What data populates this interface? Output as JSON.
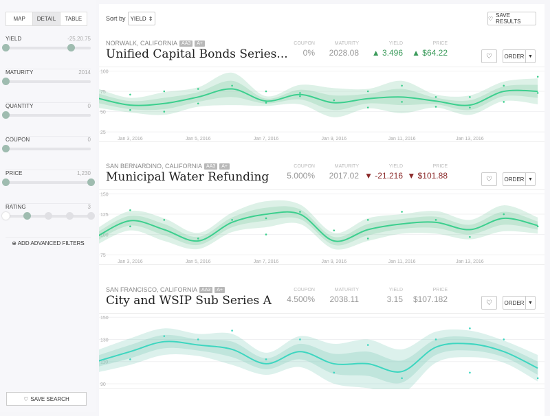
{
  "sidebar": {
    "tabs": [
      {
        "label": "MAP"
      },
      {
        "label": "DETAIL",
        "active": true
      },
      {
        "label": "TABLE"
      }
    ],
    "filters": [
      {
        "label": "YIELD",
        "value": "-25,20.75",
        "thumbs": [
          0,
          0.77
        ]
      },
      {
        "label": "MATURITY",
        "value": "2014",
        "thumbs": [
          0
        ]
      },
      {
        "label": "QUANTITY",
        "value": "0",
        "thumbs": [
          0
        ]
      },
      {
        "label": "COUPON",
        "value": "0",
        "thumbs": [
          0
        ]
      },
      {
        "label": "PRICE",
        "value": "1,230",
        "thumbs": [
          0,
          1
        ]
      },
      {
        "label": "RATING",
        "value": "3",
        "steps": 5,
        "selected_step": 1
      }
    ],
    "add_filters": "ADD ADVANCED FILTERS",
    "save_search": "SAVE SEARCH"
  },
  "toolbar": {
    "sort_label": "Sort by",
    "sort_value": "YIELD",
    "save_results": "SAVE RESULTS"
  },
  "colors": {
    "up": "#3a9a5a",
    "down": "#8b2a2a",
    "line_green": "#3ccf8e",
    "line_teal": "#3dd6c0"
  },
  "bonds": [
    {
      "location": "NORWALK, CALIFORNIA",
      "badges": [
        "AA3",
        "A+"
      ],
      "title": "Unified Capital Bonds Series...",
      "coupon_label": "COUPON",
      "coupon": "0%",
      "maturity_label": "MATURITY",
      "maturity": "2028.08",
      "yield_label": "YIELD",
      "yield": "3.496",
      "yield_dir": "up",
      "price_label": "PRICE",
      "price": "$64.22",
      "price_dir": "up",
      "order": "ORDER"
    },
    {
      "location": "SAN BERNARDINO, CALIFORNIA",
      "badges": [
        "AA3",
        "A+"
      ],
      "title": "Municipal Water Refunding",
      "coupon_label": "COUPON",
      "coupon": "5.000%",
      "maturity_label": "MATURITY",
      "maturity": "2017.02",
      "yield_label": "YIELD",
      "yield": "-21.216",
      "yield_dir": "down",
      "price_label": "PRICE",
      "price": "$101.88",
      "price_dir": "down",
      "order": "ORDER"
    },
    {
      "location": "SAN FRANCISCO, CALIFORNIA",
      "badges": [
        "AA3",
        "A+"
      ],
      "title": "City and WSIP Sub Series A",
      "coupon_label": "COUPON",
      "coupon": "4.500%",
      "maturity_label": "MATURITY",
      "maturity": "2038.11",
      "yield_label": "YIELD",
      "yield": "3.15",
      "yield_dir": "none",
      "price_label": "PRICE",
      "price": "$107.182",
      "price_dir": "none",
      "order": "ORDER"
    }
  ],
  "chart_data": [
    {
      "type": "line",
      "color": "#3ccf8e",
      "yticks": [
        100,
        75,
        50,
        25
      ],
      "ylim": [
        20,
        103
      ],
      "xticks": [
        "Jan 3, 2016",
        "Jan 5, 2016",
        "Jan 7, 2016",
        "Jan 9, 2016",
        "Jan 11, 2016",
        "Jan 13, 2016"
      ],
      "x": [
        "2016-01-02",
        "2016-01-03",
        "2016-01-04",
        "2016-01-05",
        "2016-01-06",
        "2016-01-07",
        "2016-01-08",
        "2016-01-09",
        "2016-01-10",
        "2016-01-11",
        "2016-01-12",
        "2016-01-13",
        "2016-01-14",
        "2016-01-15"
      ],
      "values": [
        67,
        58,
        60,
        68,
        78,
        63,
        71,
        61,
        66,
        68,
        63,
        58,
        75,
        75
      ],
      "outer_spread": [
        12,
        9,
        14,
        12,
        20,
        6,
        12,
        18,
        12,
        20,
        8,
        12,
        12,
        16
      ],
      "inner_spread": [
        6,
        5,
        7,
        6,
        10,
        3,
        6,
        9,
        6,
        10,
        4,
        6,
        6,
        8
      ],
      "points": [
        [
          2,
          80
        ],
        [
          2,
          68
        ],
        [
          3,
          71
        ],
        [
          3,
          52
        ],
        [
          4,
          75
        ],
        [
          4,
          50
        ],
        [
          5,
          78
        ],
        [
          5,
          60
        ],
        [
          6,
          82
        ],
        [
          7,
          75
        ],
        [
          7,
          61
        ],
        [
          8,
          73
        ],
        [
          8,
          69
        ],
        [
          9,
          64
        ],
        [
          10,
          75
        ],
        [
          10,
          55
        ],
        [
          11,
          82
        ],
        [
          11,
          62
        ],
        [
          12,
          68
        ],
        [
          12,
          56
        ],
        [
          13,
          68
        ],
        [
          13,
          55
        ],
        [
          14,
          82
        ],
        [
          14,
          62
        ],
        [
          15,
          93
        ],
        [
          15,
          73
        ]
      ]
    },
    {
      "type": "line",
      "color": "#3ccf8e",
      "yticks": [
        150,
        125,
        100,
        75
      ],
      "ylim": [
        70,
        153
      ],
      "xticks": [
        "Jan 3, 2016",
        "Jan 5, 2016",
        "Jan 7, 2016",
        "Jan 9, 2016",
        "Jan 11, 2016",
        "Jan 13, 2016"
      ],
      "x": [
        "2016-01-02",
        "2016-01-03",
        "2016-01-04",
        "2016-01-05",
        "2016-01-06",
        "2016-01-07",
        "2016-01-08",
        "2016-01-09",
        "2016-01-10",
        "2016-01-11",
        "2016-01-12",
        "2016-01-13",
        "2016-01-14",
        "2016-01-15"
      ],
      "values": [
        97,
        117,
        106,
        92,
        115,
        125,
        125,
        92,
        106,
        113,
        115,
        106,
        120,
        111
      ],
      "outer_spread": [
        10,
        12,
        14,
        10,
        12,
        16,
        12,
        10,
        14,
        12,
        14,
        12,
        16,
        10
      ],
      "inner_spread": [
        5,
        6,
        7,
        5,
        6,
        8,
        6,
        5,
        7,
        6,
        7,
        6,
        8,
        5
      ],
      "points": [
        [
          3,
          130
        ],
        [
          3,
          110
        ],
        [
          4,
          118
        ],
        [
          5,
          95
        ],
        [
          6,
          118
        ],
        [
          7,
          120
        ],
        [
          7,
          100
        ],
        [
          8,
          128
        ],
        [
          9,
          105
        ],
        [
          10,
          118
        ],
        [
          10,
          95
        ],
        [
          11,
          128
        ],
        [
          12,
          118
        ],
        [
          13,
          97
        ],
        [
          14,
          125
        ],
        [
          15,
          110
        ]
      ]
    },
    {
      "type": "line",
      "color": "#3dd6c0",
      "yticks": [
        150,
        130,
        110,
        90
      ],
      "ylim": [
        85,
        152
      ],
      "xticks": [],
      "x": [
        "2016-01-02",
        "2016-01-03",
        "2016-01-04",
        "2016-01-05",
        "2016-01-06",
        "2016-01-07",
        "2016-01-08",
        "2016-01-09",
        "2016-01-10",
        "2016-01-11",
        "2016-01-12",
        "2016-01-13",
        "2016-01-14",
        "2016-01-15"
      ],
      "values": [
        110,
        119,
        128,
        125,
        121,
        108,
        119,
        108,
        108,
        101,
        123,
        126,
        119,
        104
      ],
      "outer_spread": [
        10,
        12,
        12,
        10,
        14,
        10,
        14,
        18,
        22,
        20,
        14,
        12,
        10,
        12
      ],
      "inner_spread": [
        5,
        6,
        6,
        5,
        7,
        5,
        7,
        9,
        11,
        10,
        7,
        6,
        5,
        6
      ],
      "points": [
        [
          2,
          128
        ],
        [
          3,
          112
        ],
        [
          4,
          133
        ],
        [
          5,
          130
        ],
        [
          6,
          138
        ],
        [
          7,
          112
        ],
        [
          8,
          130
        ],
        [
          9,
          100
        ],
        [
          10,
          125
        ],
        [
          11,
          95
        ],
        [
          12,
          130
        ],
        [
          13,
          140
        ],
        [
          13,
          100
        ],
        [
          14,
          130
        ],
        [
          15,
          95
        ]
      ]
    }
  ]
}
